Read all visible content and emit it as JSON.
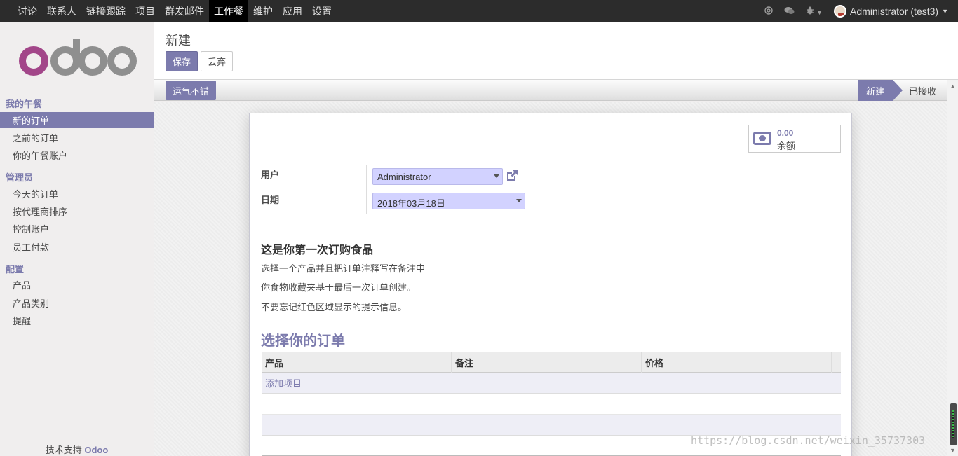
{
  "topmenu": {
    "items": [
      "讨论",
      "联系人",
      "链接跟踪",
      "项目",
      "群发邮件",
      "工作餐",
      "维护",
      "应用",
      "设置"
    ],
    "active_index": 5
  },
  "topright": {
    "user_label": "Administrator (test3)"
  },
  "sidebar": {
    "sections": [
      {
        "title": "我的午餐",
        "items": [
          "新的订单",
          "之前的订单",
          "你的午餐账户"
        ]
      },
      {
        "title": "管理员",
        "items": [
          "今天的订单",
          "按代理商排序",
          "控制账户",
          "员工付款"
        ]
      },
      {
        "title": "配置",
        "items": [
          "产品",
          "产品类别",
          "提醒"
        ]
      }
    ],
    "active_item": "新的订单",
    "powered_prefix": "技术支持",
    "powered_brand": "Odoo"
  },
  "control_panel": {
    "breadcrumb": "新建",
    "save_label": "保存",
    "discard_label": "丢弃"
  },
  "statusbar": {
    "button_label": "运气不错",
    "stages": [
      "新建",
      "已接收"
    ],
    "current_stage": "新建"
  },
  "form": {
    "balance_value": "0.00",
    "balance_label": "余额",
    "user_label": "用户",
    "user_value": "Administrator",
    "date_label": "日期",
    "date_value": "2018年03月18日",
    "info_title": "这是你第一次订购食品",
    "info_lines": [
      "选择一个产品并且把订单注释写在备注中",
      "你食物收藏夹基于最后一次订单创建。",
      "不要忘记红色区域显示的提示信息。"
    ],
    "order_title": "选择你的订单",
    "table_headers": [
      "产品",
      "备注",
      "价格"
    ],
    "add_item_label": "添加项目"
  },
  "watermark": "https://blog.csdn.net/weixin_35737303",
  "colors": {
    "brand": "#7c7bad",
    "topbar": "#2c2c2c",
    "select_bg": "#d2d2ff"
  }
}
